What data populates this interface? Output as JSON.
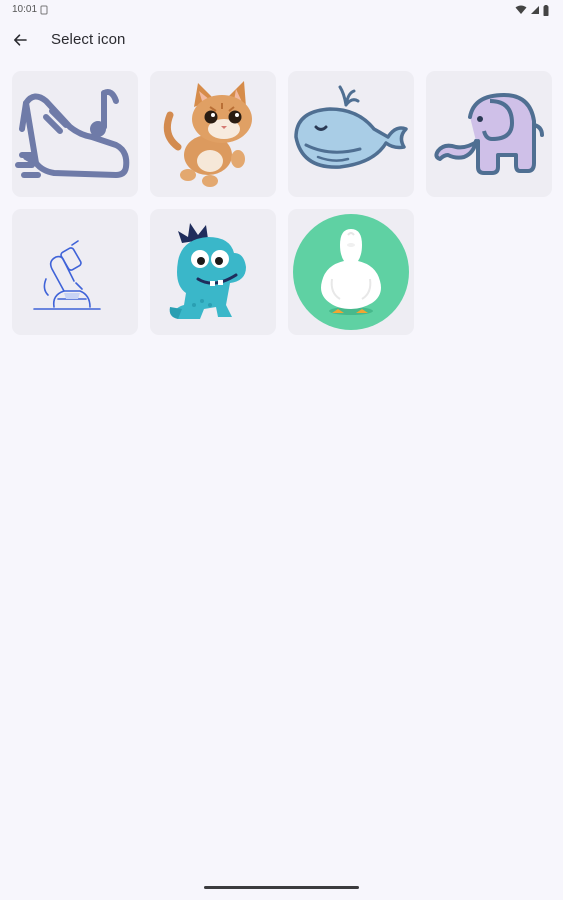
{
  "status_bar": {
    "time": "10:01"
  },
  "app_bar": {
    "title": "Select icon",
    "back_icon": "arrow-back-icon"
  },
  "icons": [
    {
      "name": "shoe-music-icon"
    },
    {
      "name": "cat-icon"
    },
    {
      "name": "whale-icon"
    },
    {
      "name": "elephant-icon"
    },
    {
      "name": "microscope-icon"
    },
    {
      "name": "dinosaur-icon"
    },
    {
      "name": "duck-icon"
    }
  ],
  "colors": {
    "background": "#f7f6fc",
    "tile": "#eeedf3",
    "shoe_stroke": "#6f7ba8",
    "whale_fill": "#a9cde6",
    "whale_stroke": "#4f6f92",
    "elephant_fill": "#cfc0e8",
    "elephant_stroke": "#4f6f92",
    "dino": "#3ab7c9",
    "duck_circle": "#5fd1a3"
  }
}
